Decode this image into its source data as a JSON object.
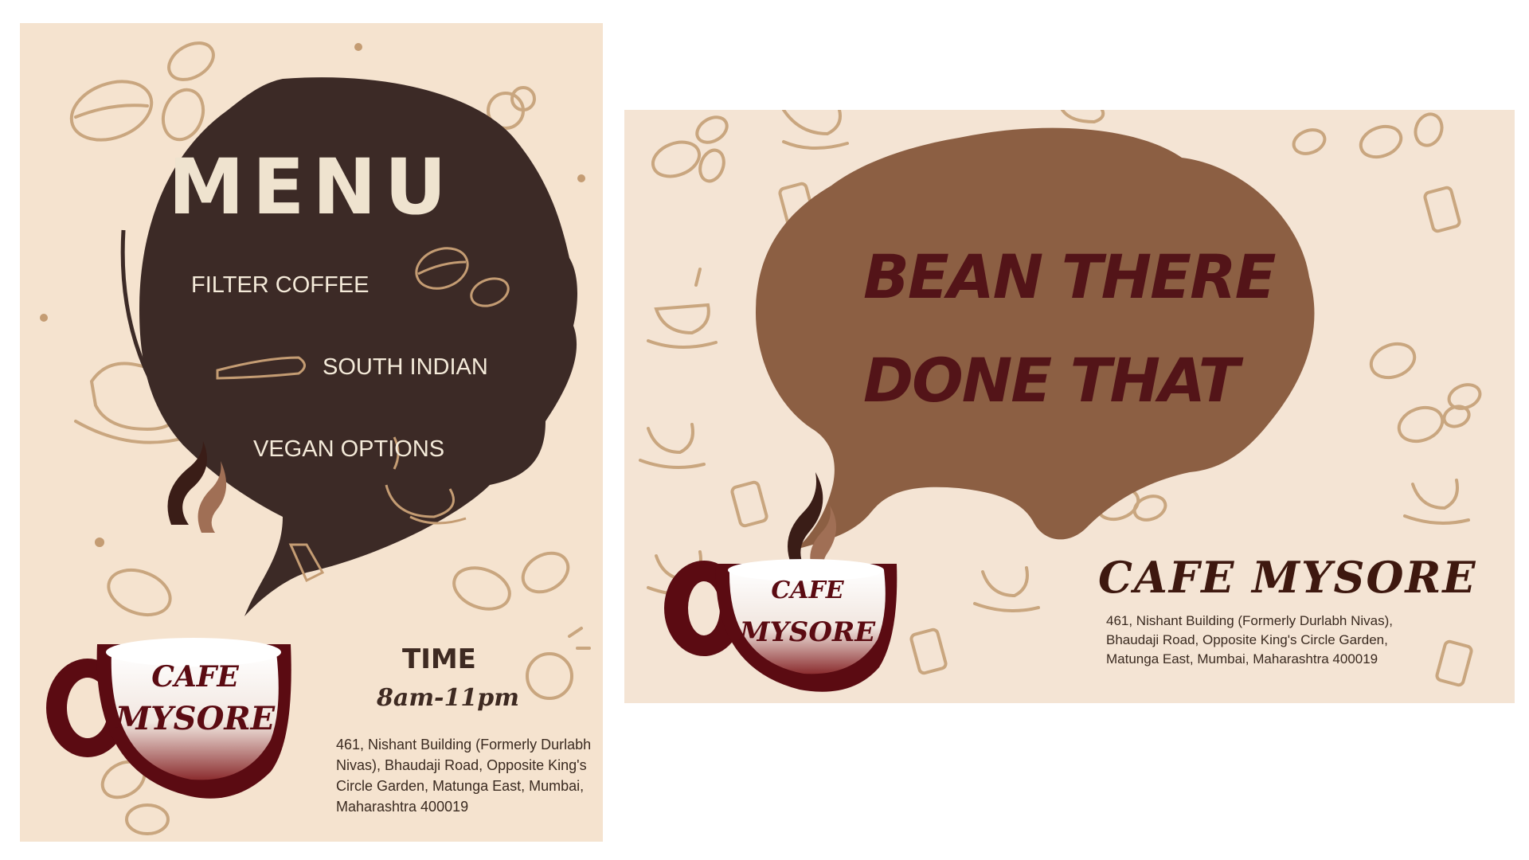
{
  "menu_poster": {
    "title": "MENU",
    "items": [
      "FILTER COFFEE",
      "SOUTH INDIAN",
      "VEGAN OPTIONS"
    ],
    "logo_line1": "CAFE",
    "logo_line2": "MYSORE",
    "time_label": "TIME",
    "time_value": "8am-11pm",
    "address": "461, Nishant Building (Formerly Durlabh Nivas), Bhaudaji Road, Opposite King's Circle Garden, Matunga East, Mumbai, Maharashtra 400019"
  },
  "banner_poster": {
    "slogan_line1": "BEAN THERE",
    "slogan_line2": "DONE THAT",
    "logo_line1": "CAFE",
    "logo_line2": "MYSORE",
    "brand_name": "CAFE MYSORE",
    "address": "461, Nishant Building (Formerly Durlabh Nivas), Bhaudaji Road, Opposite King's Circle Garden, Matunga East, Mumbai, Maharashtra 400019"
  },
  "colors": {
    "poster_bg": "#f5e3cf",
    "banner_bg": "#f4e4d4",
    "menu_bubble": "#3c2a26",
    "banner_bubble": "#8c5f43",
    "cup_maroon": "#5b0b12",
    "doodle": "#c9a67f"
  }
}
